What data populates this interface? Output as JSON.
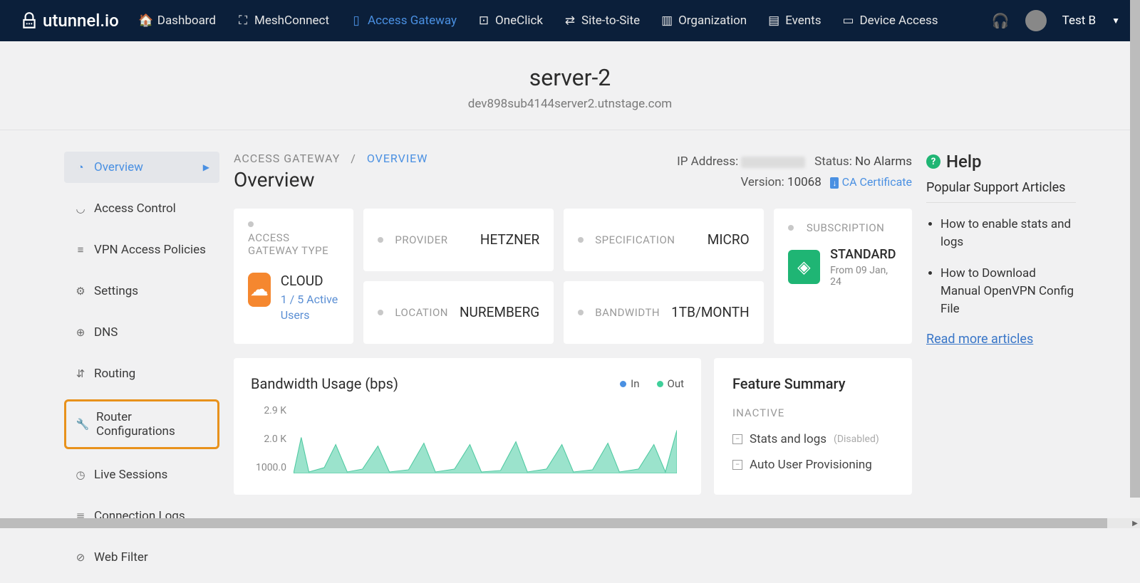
{
  "brand": "utunnel.io",
  "nav": {
    "dashboard": "Dashboard",
    "mesh": "MeshConnect",
    "gateway": "Access Gateway",
    "oneclick": "OneClick",
    "site": "Site-to-Site",
    "org": "Organization",
    "events": "Events",
    "device": "Device Access"
  },
  "user": "Test B",
  "server": {
    "name": "server-2",
    "host": "dev898sub4144server2.utnstage.com"
  },
  "sidebar": {
    "overview": "Overview",
    "access": "Access Control",
    "vpn": "VPN Access Policies",
    "settings": "Settings",
    "dns": "DNS",
    "routing": "Routing",
    "router": "Router Configurations",
    "live": "Live Sessions",
    "conn": "Connection Logs",
    "web": "Web Filter"
  },
  "bc": {
    "a": "ACCESS GATEWAY",
    "sep": "/",
    "b": "OVERVIEW"
  },
  "status": {
    "ip_label": "IP Address:",
    "status_label": "Status:",
    "status_value": "No Alarms",
    "version_label": "Version:",
    "version_value": "10068",
    "ca": "CA Certificate"
  },
  "title": "Overview",
  "cards": {
    "type_label": "ACCESS GATEWAY TYPE",
    "type_value": "CLOUD",
    "type_sub": "1 / 5 Active Users",
    "provider_label": "PROVIDER",
    "provider_value": "HETZNER",
    "location_label": "LOCATION",
    "location_value": "NUREMBERG",
    "spec_label": "SPECIFICATION",
    "spec_value": "MICRO",
    "bw_label": "BANDWIDTH",
    "bw_value": "1TB/MONTH",
    "sub_label": "SUBSCRIPTION",
    "sub_value": "STANDARD",
    "sub_date": "From 09 Jan, 24"
  },
  "chart": {
    "title": "Bandwidth Usage (bps)",
    "legend_in": "In",
    "legend_out": "Out"
  },
  "chart_data": {
    "type": "area",
    "series": [
      {
        "name": "Out",
        "color": "#6fd6b8"
      },
      {
        "name": "In",
        "color": "#4a90e2"
      }
    ],
    "ylabel": "bps",
    "ylim": [
      0,
      2900
    ],
    "y_ticks": [
      "2.9 K",
      "2.0 K",
      "1000.0"
    ]
  },
  "feature": {
    "title": "Feature Summary",
    "section": "INACTIVE",
    "item1": "Stats and logs",
    "item1_suffix": "(Disabled)",
    "item2": "Auto User Provisioning"
  },
  "help": {
    "title": "Help",
    "sub": "Popular Support Articles",
    "a1": "How to enable stats and logs",
    "a2": "How to Download Manual OpenVPN Config File",
    "more": "Read more articles"
  }
}
